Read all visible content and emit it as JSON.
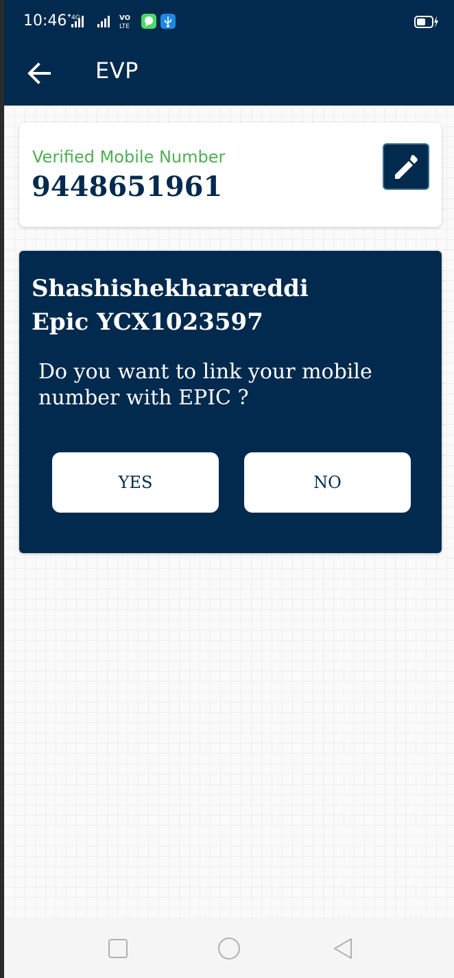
{
  "status_bar": {
    "time": "10:46",
    "network_label": "4G",
    "volte_label": "VO LTE"
  },
  "app_bar": {
    "title": "EVP"
  },
  "mobile_card": {
    "label": "Verified Mobile Number",
    "number": "9448651961"
  },
  "epic_card": {
    "name": "Shashishekharareddi",
    "epic": "Epic YCX1023597",
    "question": "Do you want to link your mobile number with EPIC ?",
    "yes_label": "YES",
    "no_label": "NO"
  },
  "colors": {
    "primary": "#022a4e",
    "verified_green": "#4caf50",
    "background": "#fafafa"
  },
  "icons": {
    "back": "arrow-left-icon",
    "edit": "pencil-icon",
    "nav_recent": "square-icon",
    "nav_home": "circle-icon",
    "nav_back": "triangle-back-icon"
  }
}
